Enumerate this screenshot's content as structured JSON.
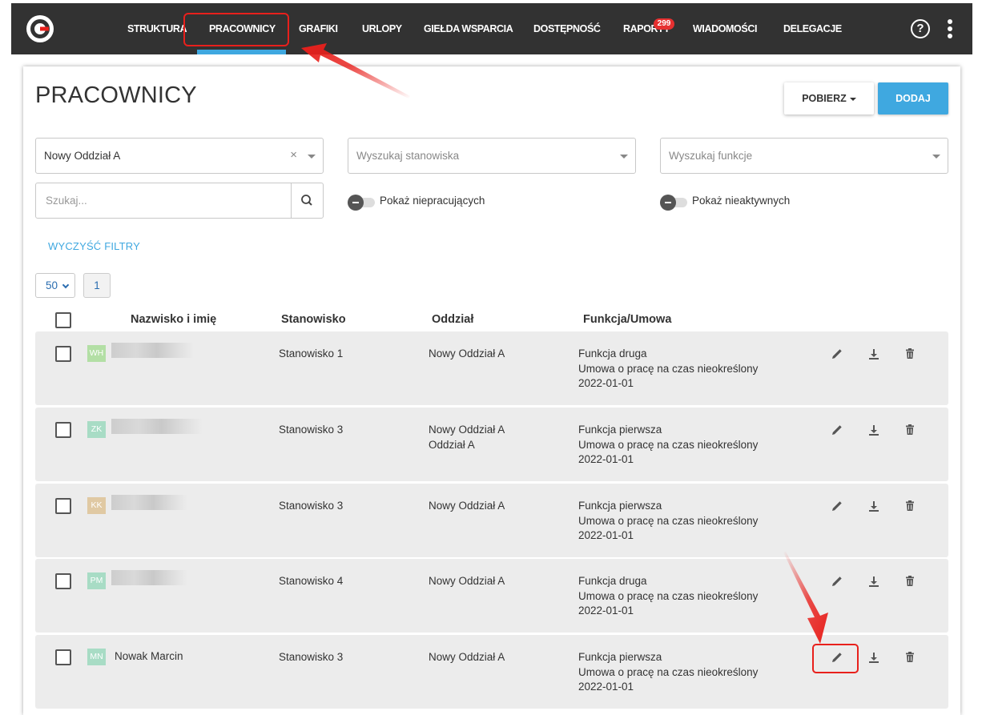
{
  "nav": {
    "items": [
      "STRUKTURA",
      "PRACOWNICY",
      "GRAFIKI",
      "URLOPY",
      "GIEŁDA WSPARCIA",
      "DOSTĘPNOŚĆ",
      "RAPORTY",
      "WIADOMOŚCI",
      "DELEGACJE"
    ],
    "active": "PRACOWNICY",
    "reports_badge": "299",
    "help_icon": "help-circle-icon",
    "menu_icon": "kebab-menu-icon",
    "accent": "#3fa8e0",
    "bar_color": "#323232"
  },
  "page": {
    "title": "PRACOWNICY",
    "download_label": "POBIERZ",
    "add_label": "DODAJ"
  },
  "filters": {
    "branch_value": "Nowy Oddział A",
    "branch_clear": "×",
    "position_placeholder": "Wyszukaj stanowiska",
    "function_placeholder": "Wyszukaj funkcje",
    "search_placeholder": "Szukaj...",
    "show_not_working": "Pokaż niepracujących",
    "show_inactive": "Pokaż nieaktywnych",
    "clear_label": "WYCZYŚĆ FILTRY"
  },
  "pagination": {
    "per_page": "50",
    "page": "1"
  },
  "table": {
    "headers": {
      "name": "Nazwisko i imię",
      "position": "Stanowisko",
      "branch": "Oddział",
      "function": "Funkcja/Umowa"
    },
    "rows": [
      {
        "initials": "WH",
        "avatar_color": "#b3dfa5",
        "name": "",
        "name_hidden": true,
        "position": "Stanowisko 1",
        "branch": [
          "Nowy Oddział A"
        ],
        "function": [
          "Funkcja druga",
          "Umowa o pracę na czas nieokreślony",
          "2022-01-01"
        ]
      },
      {
        "initials": "ZK",
        "avatar_color": "#a8dcc5",
        "name": "",
        "name_hidden": true,
        "position": "Stanowisko 3",
        "branch": [
          "Nowy Oddział A",
          "Oddział A"
        ],
        "function": [
          "Funkcja pierwsza",
          "Umowa o pracę na czas nieokreślony",
          "2022-01-01"
        ]
      },
      {
        "initials": "KK",
        "avatar_color": "#e0c9a3",
        "name": "",
        "name_hidden": true,
        "position": "Stanowisko 3",
        "branch": [
          "Nowy Oddział A"
        ],
        "function": [
          "Funkcja pierwsza",
          "Umowa o pracę na czas nieokreślony",
          "2022-01-01"
        ]
      },
      {
        "initials": "PM",
        "avatar_color": "#a8dcc5",
        "name": "",
        "name_hidden": true,
        "position": "Stanowisko 4",
        "branch": [
          "Nowy Oddział A"
        ],
        "function": [
          "Funkcja druga",
          "Umowa o pracę na czas nieokreślony",
          "2022-01-01"
        ]
      },
      {
        "initials": "MN",
        "avatar_color": "#a8dcc5",
        "name": "Nowak Marcin",
        "name_hidden": false,
        "position": "Stanowisko 3",
        "branch": [
          "Nowy Oddział A"
        ],
        "function": [
          "Funkcja pierwsza",
          "Umowa o pracę na czas nieokreślony",
          "2022-01-01"
        ]
      }
    ],
    "row_actions": [
      "pencil-icon",
      "download-icon",
      "trash-icon"
    ]
  },
  "annotations": {
    "color": "#e8201c"
  }
}
